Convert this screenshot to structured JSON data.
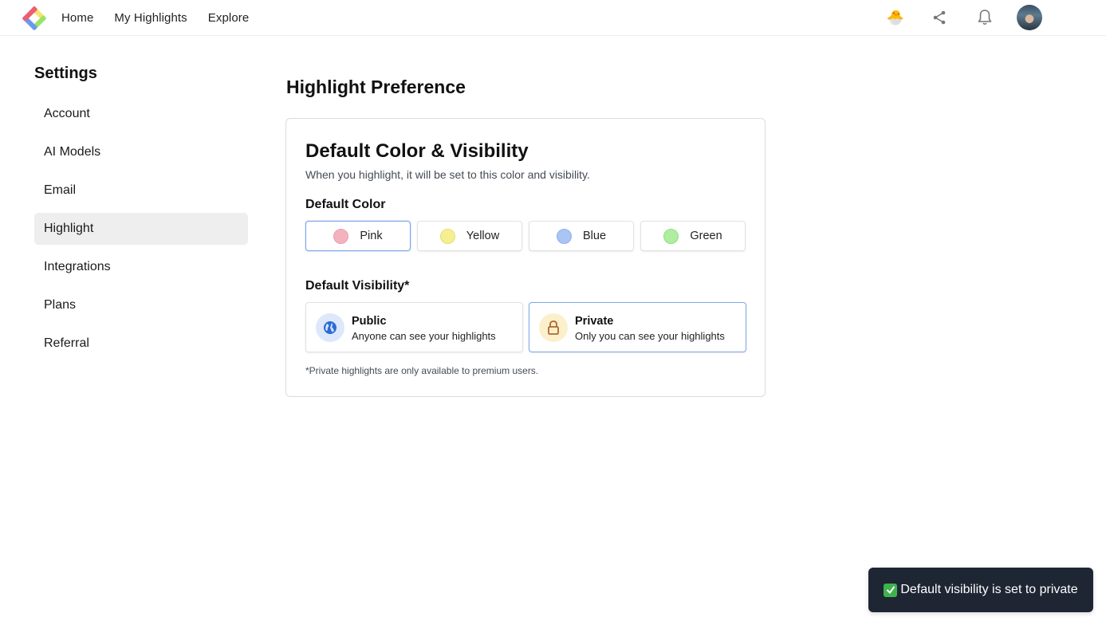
{
  "topbar": {
    "logo_name": "app-logo",
    "nav": [
      {
        "label": "Home"
      },
      {
        "label": "My Highlights"
      },
      {
        "label": "Explore"
      }
    ],
    "icons": [
      "hatching-chick-icon",
      "share-icon",
      "bell-icon",
      "avatar"
    ],
    "chick_emoji": "🐣"
  },
  "sidebar": {
    "title": "Settings",
    "items": [
      {
        "label": "Account",
        "active": false
      },
      {
        "label": "AI Models",
        "active": false
      },
      {
        "label": "Email",
        "active": false
      },
      {
        "label": "Highlight",
        "active": true
      },
      {
        "label": "Integrations",
        "active": false
      },
      {
        "label": "Plans",
        "active": false
      },
      {
        "label": "Referral",
        "active": false
      }
    ]
  },
  "main": {
    "page_title": "Highlight Preference",
    "card": {
      "title": "Default Color & Visibility",
      "subtitle": "When you highlight, it will be set to this color and visibility.",
      "color_label": "Default Color",
      "colors": [
        {
          "label": "Pink",
          "swatch": "#f4b2bf",
          "selected": true
        },
        {
          "label": "Yellow",
          "swatch": "#f6ef8f",
          "selected": false
        },
        {
          "label": "Blue",
          "swatch": "#aac4f6",
          "selected": false
        },
        {
          "label": "Green",
          "swatch": "#aeeea0",
          "selected": false
        }
      ],
      "visibility_label": "Default Visibility*",
      "visibility_options": [
        {
          "title": "Public",
          "description": "Anyone can see your highlights",
          "icon": "globe-icon",
          "icon_bg": "#dde8fb",
          "icon_color": "#2d6bd6",
          "selected": false
        },
        {
          "title": "Private",
          "description": "Only you can see your highlights",
          "icon": "lock-icon",
          "icon_bg": "#fcefcc",
          "icon_color": "#b0672d",
          "selected": true
        }
      ],
      "note": "*Private highlights are only available to premium users."
    }
  },
  "toast": {
    "message": "Default visibility is set to private",
    "icon": "check-mark-icon"
  },
  "colors": {
    "selected_border": "#7ea6e8",
    "toast_bg": "#1f2633",
    "active_sidebar_bg": "#eeeeee"
  }
}
